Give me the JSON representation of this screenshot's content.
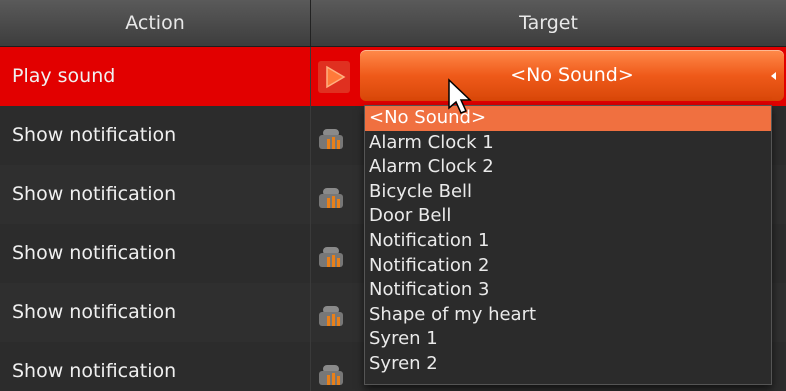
{
  "header": {
    "action": "Action",
    "target": "Target"
  },
  "rows": [
    {
      "action": "Play sound",
      "icon": "play-icon",
      "selected": true
    },
    {
      "action": "Show notification",
      "icon": "notification-icon"
    },
    {
      "action": "Show notification",
      "icon": "notification-icon"
    },
    {
      "action": "Show notification",
      "icon": "notification-icon"
    },
    {
      "action": "Show notification",
      "icon": "notification-icon"
    },
    {
      "action": "Show notification",
      "icon": "notification-icon"
    }
  ],
  "combo": {
    "value": "<No Sound>"
  },
  "dropdown": {
    "options": [
      "<No Sound>",
      "Alarm Clock 1",
      "Alarm Clock 2",
      "Bicycle Bell",
      "Door Bell",
      "Notification 1",
      "Notification 2",
      "Notification 3",
      "Shape of my heart",
      "Syren 1",
      "Syren 2"
    ],
    "highlighted_index": 0
  },
  "colors": {
    "selected_row": "#e20000",
    "combo_accent": "#ef5a1a",
    "highlight": "#f07040"
  }
}
